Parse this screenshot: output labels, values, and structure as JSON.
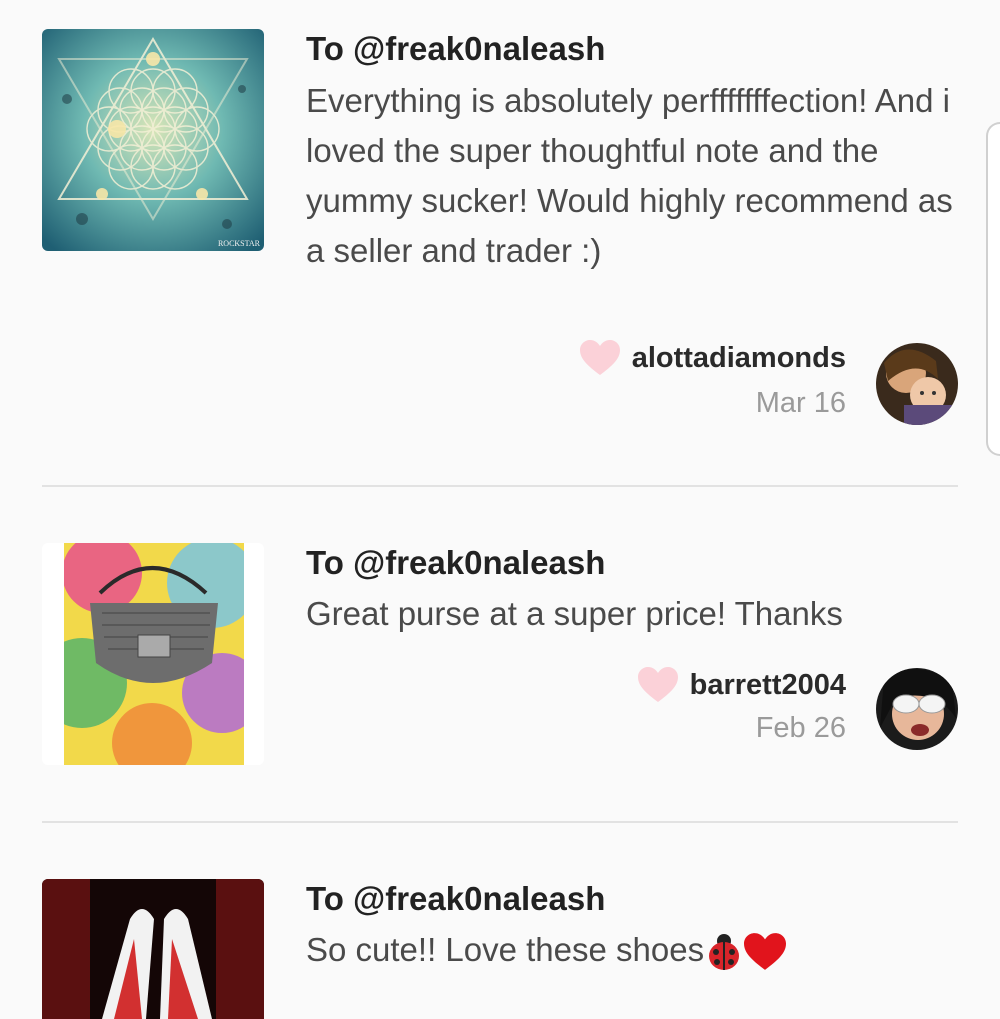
{
  "colors": {
    "heart": "#fbd1d8",
    "divider": "#e2e2e2",
    "date": "#9a9a9a",
    "text": "#4a4a4a"
  },
  "feedback": [
    {
      "recipient": "To @freak0naleash",
      "message": "Everything is absolutely perfffffffection! And i loved the super thoughtful note and the yummy sucker! Would highly recommend as a seller and trader :)",
      "username": "alottadiamonds",
      "date": "Mar 16",
      "thumb": "sacred-geometry-art-thumbnail",
      "thumb_watermark": "ROCKSTAR"
    },
    {
      "recipient": "To @freak0naleash",
      "message": "Great purse at a super price! Thanks",
      "username": "barrett2004",
      "date": "Feb 26",
      "thumb": "purse-on-tie-dye-thumbnail"
    },
    {
      "recipient": "To @freak0naleash",
      "message": "So cute!! Love these shoes",
      "message_emoji": [
        "ladybug-icon",
        "red-heart-icon"
      ],
      "thumb": "red-shoes-thumbnail"
    }
  ]
}
